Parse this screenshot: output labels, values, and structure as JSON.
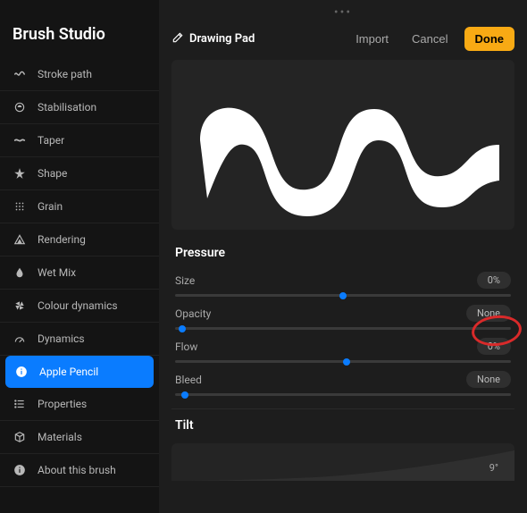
{
  "app": {
    "title": "Brush Studio"
  },
  "sidebar": {
    "items": [
      {
        "label": "Stroke path"
      },
      {
        "label": "Stabilisation"
      },
      {
        "label": "Taper"
      },
      {
        "label": "Shape"
      },
      {
        "label": "Grain"
      },
      {
        "label": "Rendering"
      },
      {
        "label": "Wet Mix"
      },
      {
        "label": "Colour dynamics"
      },
      {
        "label": "Dynamics"
      },
      {
        "label": "Apple Pencil"
      },
      {
        "label": "Properties"
      },
      {
        "label": "Materials"
      },
      {
        "label": "About this brush"
      }
    ]
  },
  "topbar": {
    "drawing_pad": "Drawing Pad",
    "import": "Import",
    "cancel": "Cancel",
    "done": "Done"
  },
  "sections": {
    "pressure": {
      "title": "Pressure",
      "sliders": [
        {
          "label": "Size",
          "value": "0%",
          "pos": 50
        },
        {
          "label": "Opacity",
          "value": "None",
          "pos": 2
        },
        {
          "label": "Flow",
          "value": "0%",
          "pos": 51
        },
        {
          "label": "Bleed",
          "value": "None",
          "pos": 3
        }
      ]
    },
    "tilt": {
      "title": "Tilt",
      "value": "9°"
    }
  },
  "colors": {
    "accent": "#0a7cff",
    "done": "#f8aa14"
  }
}
